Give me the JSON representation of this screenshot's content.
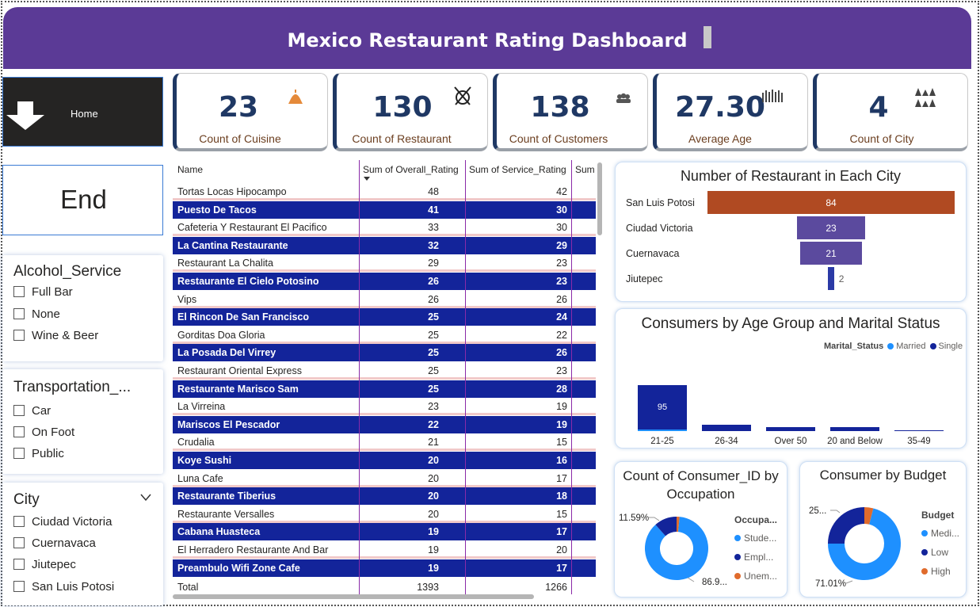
{
  "header": {
    "title": "Mexico Restaurant Rating Dashboard"
  },
  "nav": {
    "home_label": "Home",
    "end_label": "End"
  },
  "slicers": {
    "alcohol": {
      "title": "Alcohol_Service",
      "options": [
        "Full Bar",
        "None",
        "Wine & Beer"
      ]
    },
    "transport": {
      "title": "Transportation_...",
      "options": [
        "Car",
        "On Foot",
        "Public"
      ]
    },
    "city": {
      "title": "City",
      "options": [
        "Ciudad Victoria",
        "Cuernavaca",
        "Jiutepec",
        "San Luis Potosi"
      ]
    }
  },
  "kpis": [
    {
      "value": "23",
      "label": "Count of Cuisine",
      "icon": "cuisine-icon"
    },
    {
      "value": "130",
      "label": "Count of Restaurant",
      "icon": "restaurant-icon"
    },
    {
      "value": "138",
      "label": "Count of Customers",
      "icon": "customers-icon"
    },
    {
      "value": "27.30",
      "label": "Average Age",
      "icon": "age-icon"
    },
    {
      "value": "4",
      "label": "Count of City",
      "icon": "city-icon"
    }
  ],
  "table": {
    "headers": [
      "Name",
      "Sum of Overall_Rating",
      "Sum of Service_Rating",
      "Sum"
    ],
    "rows": [
      [
        "Tortas Locas Hipocampo",
        "48",
        "42"
      ],
      [
        "Puesto De Tacos",
        "41",
        "30"
      ],
      [
        "Cafeteria Y Restaurant El Pacifico",
        "33",
        "30"
      ],
      [
        "La Cantina Restaurante",
        "32",
        "29"
      ],
      [
        "Restaurant La Chalita",
        "29",
        "23"
      ],
      [
        "Restaurante El Cielo Potosino",
        "26",
        "23"
      ],
      [
        "Vips",
        "26",
        "26"
      ],
      [
        "El Rincon De San Francisco",
        "25",
        "24"
      ],
      [
        "Gorditas Doa Gloria",
        "25",
        "22"
      ],
      [
        "La Posada Del Virrey",
        "25",
        "26"
      ],
      [
        "Restaurant Oriental Express",
        "25",
        "23"
      ],
      [
        "Restaurante Marisco Sam",
        "25",
        "28"
      ],
      [
        "La Virreina",
        "23",
        "19"
      ],
      [
        "Mariscos El Pescador",
        "22",
        "19"
      ],
      [
        "Crudalia",
        "21",
        "15"
      ],
      [
        "Koye Sushi",
        "20",
        "16"
      ],
      [
        "Luna Cafe",
        "20",
        "17"
      ],
      [
        "Restaurante Tiberius",
        "20",
        "18"
      ],
      [
        "Restaurante Versalles",
        "20",
        "15"
      ],
      [
        "Cabana Huasteca",
        "19",
        "17"
      ],
      [
        "El Herradero Restaurante And Bar",
        "19",
        "20"
      ],
      [
        "Preambulo Wifi Zone Cafe",
        "19",
        "17"
      ]
    ],
    "total": [
      "Total",
      "1393",
      "1266"
    ]
  },
  "chart_data": [
    {
      "type": "bar",
      "title": "Number of Restaurant in Each City",
      "categories": [
        "San Luis Potosi",
        "Ciudad Victoria",
        "Cuernavaca",
        "Jiutepec"
      ],
      "values": [
        84,
        23,
        21,
        2
      ],
      "colors": [
        "#b04a22",
        "#5b4a9e",
        "#5b4a9e",
        "#2b3aa6"
      ]
    },
    {
      "type": "bar",
      "title": "Consumers by Age Group and Marital Status",
      "legend_title": "Marital_Status",
      "categories": [
        "21-25",
        "26-34",
        "Over 50",
        "20 and Below",
        "35-49"
      ],
      "series": [
        {
          "name": "Married",
          "color": "#1e90ff",
          "values": [
            3,
            0,
            0,
            0,
            0
          ]
        },
        {
          "name": "Single",
          "color": "#13249a",
          "values": [
            95,
            13,
            9,
            8,
            1
          ]
        }
      ],
      "data_labels": [
        "95"
      ]
    },
    {
      "type": "pie",
      "title": "Count of Consumer_ID by Occupation",
      "legend_title": "Occupa...",
      "labels": [
        "Stude...",
        "Empl...",
        "Unem..."
      ],
      "values": [
        86.9,
        11.59,
        1.51
      ],
      "value_labels": [
        "86.9...",
        "11.59%"
      ],
      "colors": [
        "#1e90ff",
        "#13249a",
        "#e06b2c"
      ]
    },
    {
      "type": "pie",
      "title": "Consumer by Budget",
      "legend_title": "Budget",
      "labels": [
        "Medi...",
        "Low",
        "High"
      ],
      "values": [
        71.01,
        25.0,
        3.99
      ],
      "value_labels": [
        "71.01%",
        "25..."
      ],
      "colors": [
        "#1e90ff",
        "#13249a",
        "#e06b2c"
      ]
    }
  ]
}
